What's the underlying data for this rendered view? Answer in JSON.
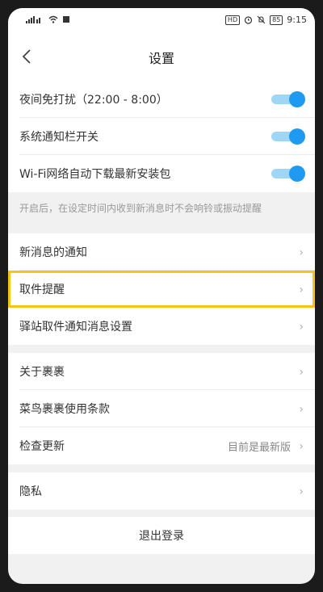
{
  "status_bar": {
    "hd_badge": "HD",
    "battery": "85",
    "time": "9:15"
  },
  "header": {
    "title": "设置",
    "back_icon": "chevron-left-icon"
  },
  "toggles": [
    {
      "label": "夜间免打扰（22:00 - 8:00）",
      "on": true
    },
    {
      "label": "系统通知栏开关",
      "on": true
    },
    {
      "label": "Wi-Fi网络自动下载最新安装包",
      "on": true
    }
  ],
  "note": "开启后，在设定时间内收到新消息时不会响铃或振动提醒",
  "group1": [
    {
      "label": "新消息的通知"
    },
    {
      "label": "取件提醒"
    },
    {
      "label": "驿站取件通知消息设置"
    }
  ],
  "group2": [
    {
      "label": "关于裹裹"
    },
    {
      "label": "菜鸟裹裹使用条款"
    },
    {
      "label": "检查更新",
      "value": "目前是最新版"
    }
  ],
  "privacy": {
    "label": "隐私"
  },
  "logout": "退出登录",
  "colors": {
    "toggle_on": "#1e9bf0",
    "highlight": "#f5c418"
  },
  "chevron": "›"
}
